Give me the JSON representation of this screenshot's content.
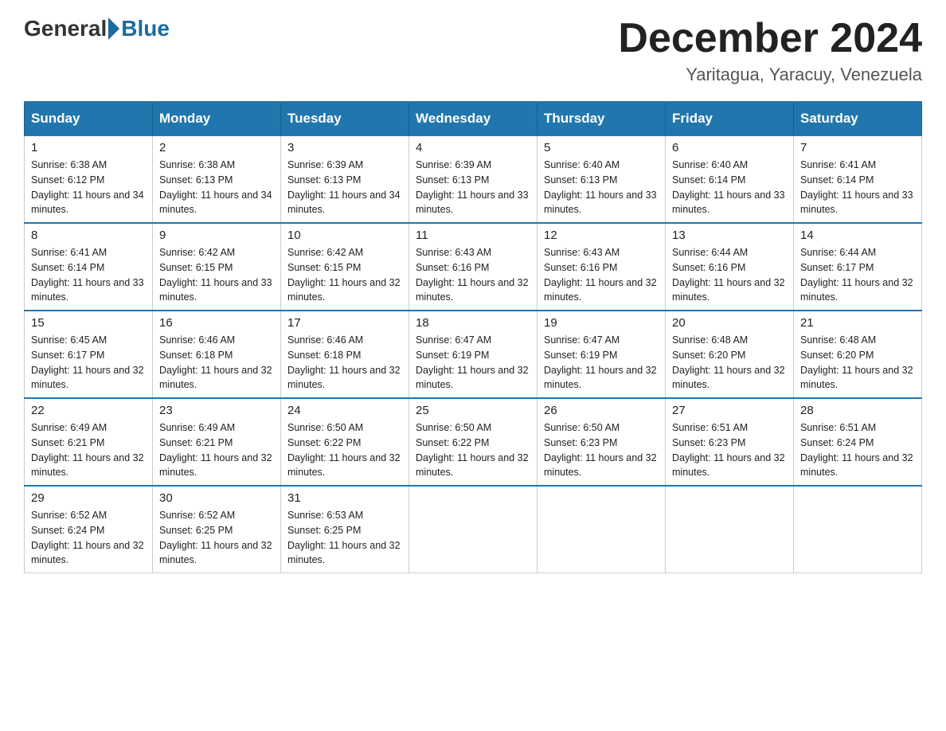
{
  "header": {
    "logo_general": "General",
    "logo_blue": "Blue",
    "month_title": "December 2024",
    "subtitle": "Yaritagua, Yaracuy, Venezuela"
  },
  "days_of_week": [
    "Sunday",
    "Monday",
    "Tuesday",
    "Wednesday",
    "Thursday",
    "Friday",
    "Saturday"
  ],
  "weeks": [
    [
      {
        "day": "1",
        "sunrise": "6:38 AM",
        "sunset": "6:12 PM",
        "daylight": "11 hours and 34 minutes."
      },
      {
        "day": "2",
        "sunrise": "6:38 AM",
        "sunset": "6:13 PM",
        "daylight": "11 hours and 34 minutes."
      },
      {
        "day": "3",
        "sunrise": "6:39 AM",
        "sunset": "6:13 PM",
        "daylight": "11 hours and 34 minutes."
      },
      {
        "day": "4",
        "sunrise": "6:39 AM",
        "sunset": "6:13 PM",
        "daylight": "11 hours and 33 minutes."
      },
      {
        "day": "5",
        "sunrise": "6:40 AM",
        "sunset": "6:13 PM",
        "daylight": "11 hours and 33 minutes."
      },
      {
        "day": "6",
        "sunrise": "6:40 AM",
        "sunset": "6:14 PM",
        "daylight": "11 hours and 33 minutes."
      },
      {
        "day": "7",
        "sunrise": "6:41 AM",
        "sunset": "6:14 PM",
        "daylight": "11 hours and 33 minutes."
      }
    ],
    [
      {
        "day": "8",
        "sunrise": "6:41 AM",
        "sunset": "6:14 PM",
        "daylight": "11 hours and 33 minutes."
      },
      {
        "day": "9",
        "sunrise": "6:42 AM",
        "sunset": "6:15 PM",
        "daylight": "11 hours and 33 minutes."
      },
      {
        "day": "10",
        "sunrise": "6:42 AM",
        "sunset": "6:15 PM",
        "daylight": "11 hours and 32 minutes."
      },
      {
        "day": "11",
        "sunrise": "6:43 AM",
        "sunset": "6:16 PM",
        "daylight": "11 hours and 32 minutes."
      },
      {
        "day": "12",
        "sunrise": "6:43 AM",
        "sunset": "6:16 PM",
        "daylight": "11 hours and 32 minutes."
      },
      {
        "day": "13",
        "sunrise": "6:44 AM",
        "sunset": "6:16 PM",
        "daylight": "11 hours and 32 minutes."
      },
      {
        "day": "14",
        "sunrise": "6:44 AM",
        "sunset": "6:17 PM",
        "daylight": "11 hours and 32 minutes."
      }
    ],
    [
      {
        "day": "15",
        "sunrise": "6:45 AM",
        "sunset": "6:17 PM",
        "daylight": "11 hours and 32 minutes."
      },
      {
        "day": "16",
        "sunrise": "6:46 AM",
        "sunset": "6:18 PM",
        "daylight": "11 hours and 32 minutes."
      },
      {
        "day": "17",
        "sunrise": "6:46 AM",
        "sunset": "6:18 PM",
        "daylight": "11 hours and 32 minutes."
      },
      {
        "day": "18",
        "sunrise": "6:47 AM",
        "sunset": "6:19 PM",
        "daylight": "11 hours and 32 minutes."
      },
      {
        "day": "19",
        "sunrise": "6:47 AM",
        "sunset": "6:19 PM",
        "daylight": "11 hours and 32 minutes."
      },
      {
        "day": "20",
        "sunrise": "6:48 AM",
        "sunset": "6:20 PM",
        "daylight": "11 hours and 32 minutes."
      },
      {
        "day": "21",
        "sunrise": "6:48 AM",
        "sunset": "6:20 PM",
        "daylight": "11 hours and 32 minutes."
      }
    ],
    [
      {
        "day": "22",
        "sunrise": "6:49 AM",
        "sunset": "6:21 PM",
        "daylight": "11 hours and 32 minutes."
      },
      {
        "day": "23",
        "sunrise": "6:49 AM",
        "sunset": "6:21 PM",
        "daylight": "11 hours and 32 minutes."
      },
      {
        "day": "24",
        "sunrise": "6:50 AM",
        "sunset": "6:22 PM",
        "daylight": "11 hours and 32 minutes."
      },
      {
        "day": "25",
        "sunrise": "6:50 AM",
        "sunset": "6:22 PM",
        "daylight": "11 hours and 32 minutes."
      },
      {
        "day": "26",
        "sunrise": "6:50 AM",
        "sunset": "6:23 PM",
        "daylight": "11 hours and 32 minutes."
      },
      {
        "day": "27",
        "sunrise": "6:51 AM",
        "sunset": "6:23 PM",
        "daylight": "11 hours and 32 minutes."
      },
      {
        "day": "28",
        "sunrise": "6:51 AM",
        "sunset": "6:24 PM",
        "daylight": "11 hours and 32 minutes."
      }
    ],
    [
      {
        "day": "29",
        "sunrise": "6:52 AM",
        "sunset": "6:24 PM",
        "daylight": "11 hours and 32 minutes."
      },
      {
        "day": "30",
        "sunrise": "6:52 AM",
        "sunset": "6:25 PM",
        "daylight": "11 hours and 32 minutes."
      },
      {
        "day": "31",
        "sunrise": "6:53 AM",
        "sunset": "6:25 PM",
        "daylight": "11 hours and 32 minutes."
      },
      null,
      null,
      null,
      null
    ]
  ],
  "labels": {
    "sunrise": "Sunrise:",
    "sunset": "Sunset:",
    "daylight": "Daylight:"
  }
}
